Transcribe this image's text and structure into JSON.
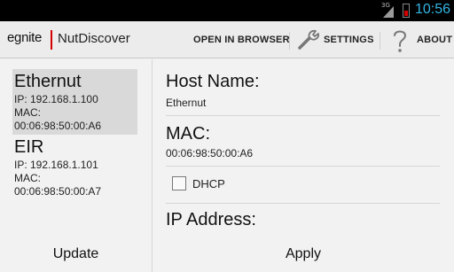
{
  "status_bar": {
    "network_label": "3G",
    "time": "10:56",
    "time_color": "#33b5e5",
    "battery_color": "#d40000"
  },
  "action_bar": {
    "logo": "egnite",
    "title": "NutDiscover",
    "open_in_browser": "OPEN IN BROWSER",
    "settings": "SETTINGS",
    "about": "ABOUT",
    "accent_color": "#d40000"
  },
  "devices": [
    {
      "name": "Ethernut",
      "ip": "IP: 192.168.1.100",
      "mac_label": "MAC:",
      "mac": "00:06:98:50:00:A6",
      "selected": true
    },
    {
      "name": "EIR",
      "ip": "IP: 192.168.1.101",
      "mac_label": "MAC:",
      "mac": "00:06:98:50:00:A7",
      "selected": false
    }
  ],
  "left_pane": {
    "update_label": "Update"
  },
  "detail": {
    "host_name_label": "Host Name:",
    "host_name_value": "Ethernut",
    "mac_label": "MAC:",
    "mac_value": "00:06:98:50:00:A6",
    "dhcp_label": "DHCP",
    "dhcp_checked": false,
    "ip_address_label": "IP Address:",
    "apply_label": "Apply"
  }
}
